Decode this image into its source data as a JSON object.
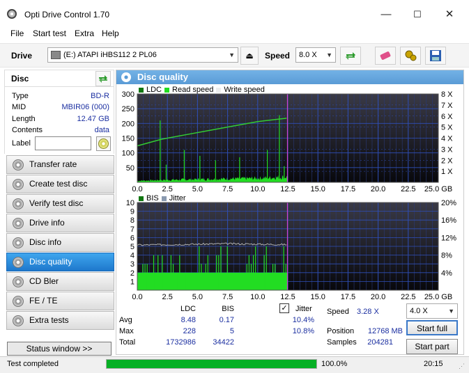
{
  "window": {
    "title": "Opti Drive Control 1.70",
    "minimize": "—",
    "maximize": "☐",
    "close": "✕"
  },
  "menu": [
    "File",
    "Start test",
    "Extra",
    "Help"
  ],
  "toolbar": {
    "drive_label": "Drive",
    "drive_value": "(E:)   ATAPI iHBS112   2 PL06",
    "speed_label": "Speed",
    "speed_value": "8.0 X"
  },
  "disc": {
    "header": "Disc",
    "fields": [
      {
        "key": "Type",
        "value": "BD-R"
      },
      {
        "key": "MID",
        "value": "MBIR06 (000)"
      },
      {
        "key": "Length",
        "value": "12.47 GB"
      },
      {
        "key": "Contents",
        "value": "data"
      }
    ],
    "label_key": "Label",
    "label_value": ""
  },
  "nav": [
    "Transfer rate",
    "Create test disc",
    "Verify test disc",
    "Drive info",
    "Disc info",
    "Disc quality",
    "CD Bler",
    "FE / TE",
    "Extra tests"
  ],
  "nav_active": "Disc quality",
  "status_window_button": "Status window >>",
  "panel_title": "Disc quality",
  "chart1_legend": {
    "ldc": "LDC",
    "read": "Read speed",
    "write": "Write speed"
  },
  "chart2_legend": {
    "bis": "BIS",
    "jitter": "Jitter"
  },
  "chart_data": [
    {
      "type": "area",
      "x_ticks": [
        "0.0",
        "2.5",
        "5.0",
        "7.5",
        "10.0",
        "12.5",
        "15.0",
        "17.5",
        "20.0",
        "22.5",
        "25.0 GB"
      ],
      "y_ticks_left": [
        "300",
        "250",
        "200",
        "150",
        "100",
        "50"
      ],
      "y_ticks_right": [
        "8 X",
        "7 X",
        "6 X",
        "5 X",
        "4 X",
        "3 X",
        "2 X",
        "1 X"
      ],
      "xlim": [
        0,
        25
      ],
      "ylim": [
        0,
        300
      ],
      "y2lim": [
        0,
        8
      ],
      "series": [
        {
          "name": "LDC",
          "color": "#22dd22",
          "baseline": [
            [
              0,
              5
            ],
            [
              2.5,
              8
            ],
            [
              5,
              10
            ],
            [
              7.5,
              12
            ],
            [
              10,
              14
            ],
            [
              12.3,
              18
            ]
          ],
          "spikes": [
            [
              1.9,
              210
            ],
            [
              2.4,
              60
            ],
            [
              3.9,
              110
            ],
            [
              5.2,
              90
            ],
            [
              6.5,
              75
            ],
            [
              8.5,
              85
            ],
            [
              10.8,
              110
            ],
            [
              11.8,
              228
            ],
            [
              12.2,
              55
            ]
          ]
        },
        {
          "name": "Read speed",
          "color": "#33cc33",
          "x": [
            0,
            2,
            4,
            6,
            8,
            10,
            12.4
          ],
          "y": [
            3.3,
            3.9,
            4.3,
            4.7,
            5.1,
            5.5,
            5.8
          ]
        }
      ],
      "marker_x": 12.47
    },
    {
      "type": "area",
      "x_ticks": [
        "0.0",
        "2.5",
        "5.0",
        "7.5",
        "10.0",
        "12.5",
        "15.0",
        "17.5",
        "20.0",
        "22.5",
        "25.0 GB"
      ],
      "y_ticks_left": [
        "10",
        "9",
        "8",
        "7",
        "6",
        "5",
        "4",
        "3",
        "2",
        "1"
      ],
      "y_ticks_right": [
        "20%",
        "16%",
        "12%",
        "8%",
        "4%"
      ],
      "xlim": [
        0,
        25
      ],
      "ylim": [
        0,
        10
      ],
      "y2lim": [
        0,
        20
      ],
      "series": [
        {
          "name": "BIS",
          "color": "#22dd22",
          "baseline": 2,
          "max": 5
        },
        {
          "name": "Jitter",
          "color": "#b0b0b0",
          "x": [
            0,
            2.5,
            5,
            7.5,
            10,
            12.4
          ],
          "y": [
            10.3,
            10.4,
            10.5,
            10.6,
            10.5,
            10.4
          ]
        }
      ],
      "marker_x": 12.47
    }
  ],
  "stats": {
    "col_ldc": "LDC",
    "col_bis": "BIS",
    "jitter_label": "Jitter",
    "rows": [
      {
        "label": "Avg",
        "ldc": "8.48",
        "bis": "0.17",
        "jitter": "10.4%"
      },
      {
        "label": "Max",
        "ldc": "228",
        "bis": "5",
        "jitter": "10.8%"
      },
      {
        "label": "Total",
        "ldc": "1732986",
        "bis": "34422",
        "jitter": ""
      }
    ],
    "speed_label": "Speed",
    "speed_value": "3.28 X",
    "position_label": "Position",
    "position_value": "12768 MB",
    "samples_label": "Samples",
    "samples_value": "204281",
    "speed_select": "4.0 X",
    "start_full": "Start full",
    "start_part": "Start part"
  },
  "status": {
    "text": "Test completed",
    "progress": 100,
    "progress_text": "100.0%",
    "time": "20:15"
  }
}
